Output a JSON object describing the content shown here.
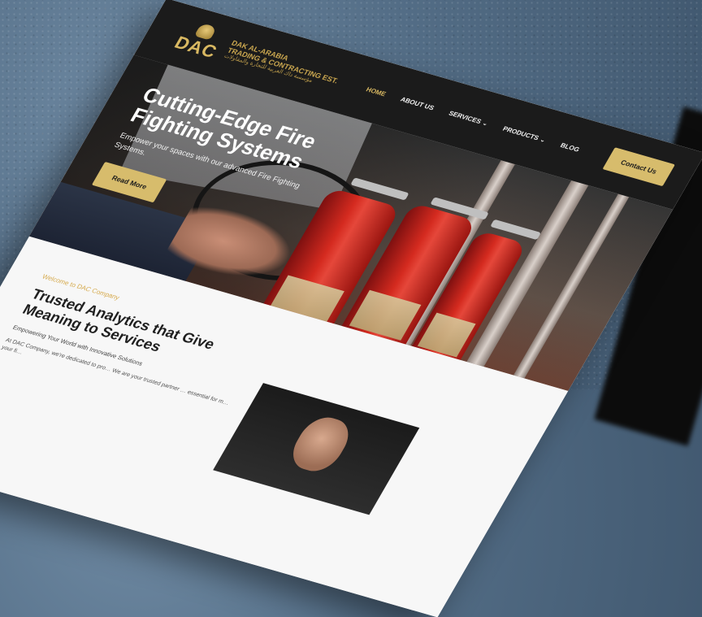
{
  "header": {
    "logo": {
      "letters": "DAC",
      "line1": "DAK AL-ARABIA",
      "line2": "TRADING & CONTRACTING EST.",
      "line3_arabic": "مؤسسة داك العربية للتجارة والمقاولات"
    },
    "nav": [
      {
        "label": "HOME",
        "active": true
      },
      {
        "label": "ABOUT US"
      },
      {
        "label": "SERVICES",
        "dropdown": true
      },
      {
        "label": "PRODUCTS",
        "dropdown": true
      },
      {
        "label": "BLOG"
      }
    ],
    "contact_button": "Contact Us"
  },
  "hero": {
    "title": "Cutting-Edge Fire Fighting Systems",
    "subtitle": "Empower your spaces with our advanced Fire Fighting Systems.",
    "button": "Read More"
  },
  "about": {
    "eyebrow": "Welcome to DAC Company",
    "title": "Trusted Analytics that Give Meaning to Services",
    "subtitle": "Empowering Your World with Innovative Solutions",
    "paragraph": "At DAC Company, we're dedicated to pro… We are your trusted partner … essential for m… your fi…"
  },
  "colors": {
    "accent": "#d7bc6c",
    "header_bg": "#1b1b1b",
    "eyebrow": "#d6aa4d"
  },
  "icons": {
    "dropdown": "chevron-down-icon"
  }
}
